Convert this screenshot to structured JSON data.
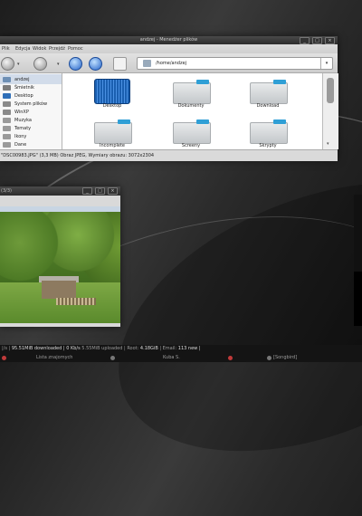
{
  "file_manager": {
    "title": "andzej - Menedżer plików",
    "menu": [
      "Plik",
      "Edycja",
      "Widok",
      "Przejdź",
      "Pomoc"
    ],
    "location": "/home/andzej",
    "sidebar": [
      {
        "label": "andzej",
        "icon": "home-icon",
        "color": "#6d8fb5",
        "selected": true
      },
      {
        "label": "Śmietnik",
        "icon": "trash-icon",
        "color": "#7c7c7c"
      },
      {
        "label": "Desktop",
        "icon": "desktop-icon",
        "color": "#2f6fb8"
      },
      {
        "label": "System plików",
        "icon": "drive-icon",
        "color": "#8a8a8a"
      },
      {
        "label": "WinXP",
        "icon": "drive-icon",
        "color": "#8a8a8a"
      },
      {
        "label": "Muzyka",
        "icon": "folder-icon",
        "color": "#9a9a9a"
      },
      {
        "label": "Tematy",
        "icon": "folder-icon",
        "color": "#9a9a9a"
      },
      {
        "label": "Ikony",
        "icon": "folder-icon",
        "color": "#9a9a9a"
      },
      {
        "label": "Dane",
        "icon": "folder-icon",
        "color": "#9a9a9a"
      }
    ],
    "files": [
      {
        "name": "Desktop",
        "icon": "desktop-folder-icon"
      },
      {
        "name": "Dokumenty",
        "icon": "folder-icon"
      },
      {
        "name": "Download",
        "icon": "folder-icon"
      },
      {
        "name": "Incomplete",
        "icon": "folder-icon"
      },
      {
        "name": "Screeny",
        "icon": "folder-icon"
      },
      {
        "name": "Skrypty",
        "icon": "folder-icon"
      }
    ],
    "status": "\"DSC00983.JPG\" (3,3 MB) Obraz JPEG, Wymiary obrazu: 3072x2304",
    "accent": "#2f9fd6"
  },
  "image_viewer": {
    "title": "(3/3)"
  },
  "taskbar": {
    "stats_prefix": "|/s |",
    "downloaded": "95.51MiB downloaded |",
    "down_rate": "0 Kb/s",
    "uploaded": "5.55MiB uploaded |",
    "root_label": "Root:",
    "root_val": "4.18GiB",
    "email_label": "| Email:",
    "email_val": "113 new |",
    "tasks": [
      "Lista znajomych",
      "Kuba S.",
      "[Songbird]"
    ]
  }
}
